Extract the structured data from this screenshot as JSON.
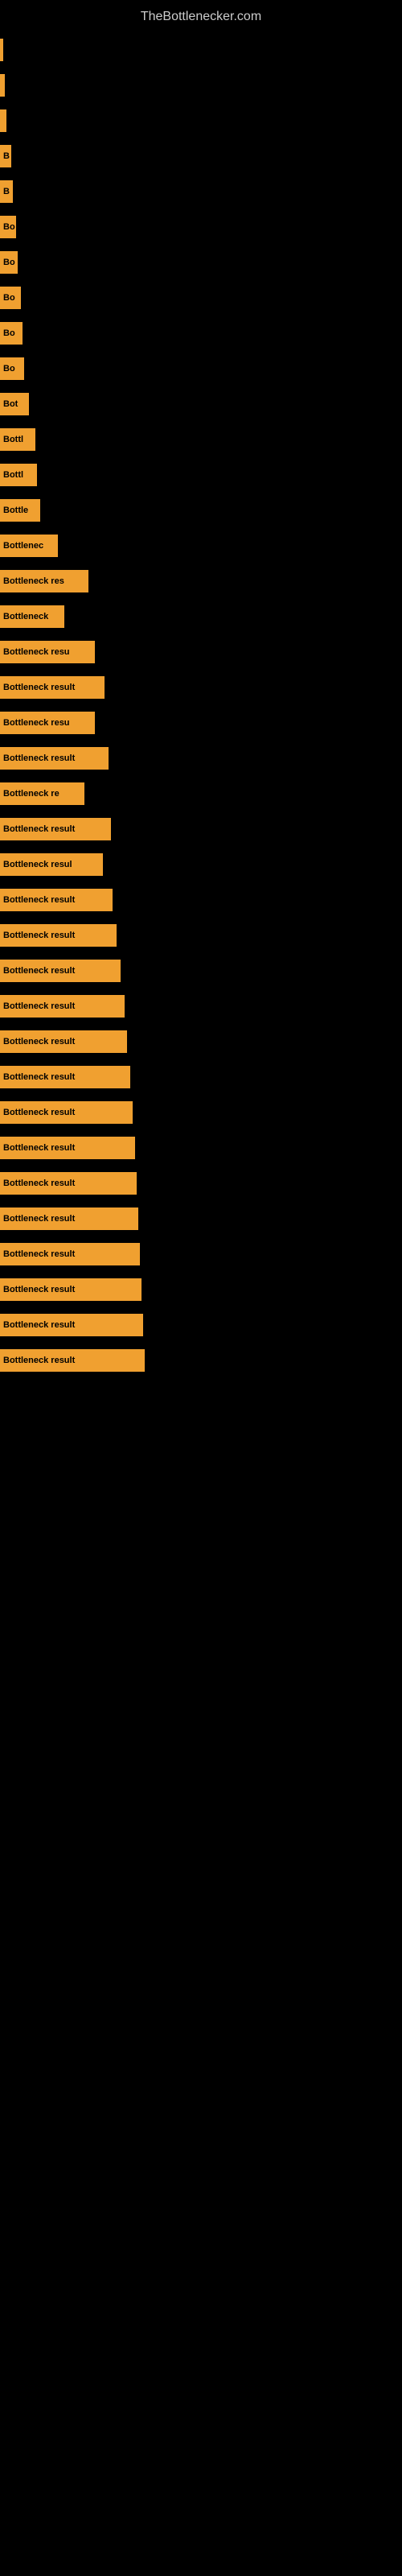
{
  "site": {
    "title": "TheBottlenecker.com"
  },
  "bars": [
    {
      "label": "",
      "width": 4
    },
    {
      "label": "",
      "width": 6
    },
    {
      "label": "",
      "width": 8
    },
    {
      "label": "B",
      "width": 14
    },
    {
      "label": "B",
      "width": 16
    },
    {
      "label": "Bo",
      "width": 20
    },
    {
      "label": "Bo",
      "width": 22
    },
    {
      "label": "Bo",
      "width": 26
    },
    {
      "label": "Bo",
      "width": 28
    },
    {
      "label": "Bo",
      "width": 30
    },
    {
      "label": "Bot",
      "width": 36
    },
    {
      "label": "Bottl",
      "width": 44
    },
    {
      "label": "Bottl",
      "width": 46
    },
    {
      "label": "Bottle",
      "width": 50
    },
    {
      "label": "Bottlenec",
      "width": 72
    },
    {
      "label": "Bottleneck res",
      "width": 110
    },
    {
      "label": "Bottleneck",
      "width": 80
    },
    {
      "label": "Bottleneck resu",
      "width": 118
    },
    {
      "label": "Bottleneck result",
      "width": 130
    },
    {
      "label": "Bottleneck resu",
      "width": 118
    },
    {
      "label": "Bottleneck result",
      "width": 135
    },
    {
      "label": "Bottleneck re",
      "width": 105
    },
    {
      "label": "Bottleneck result",
      "width": 138
    },
    {
      "label": "Bottleneck resul",
      "width": 128
    },
    {
      "label": "Bottleneck result",
      "width": 140
    },
    {
      "label": "Bottleneck result",
      "width": 145
    },
    {
      "label": "Bottleneck result",
      "width": 150
    },
    {
      "label": "Bottleneck result",
      "width": 155
    },
    {
      "label": "Bottleneck result",
      "width": 158
    },
    {
      "label": "Bottleneck result",
      "width": 162
    },
    {
      "label": "Bottleneck result",
      "width": 165
    },
    {
      "label": "Bottleneck result",
      "width": 168
    },
    {
      "label": "Bottleneck result",
      "width": 170
    },
    {
      "label": "Bottleneck result",
      "width": 172
    },
    {
      "label": "Bottleneck result",
      "width": 174
    },
    {
      "label": "Bottleneck result",
      "width": 176
    },
    {
      "label": "Bottleneck result",
      "width": 178
    },
    {
      "label": "Bottleneck result",
      "width": 180
    }
  ]
}
